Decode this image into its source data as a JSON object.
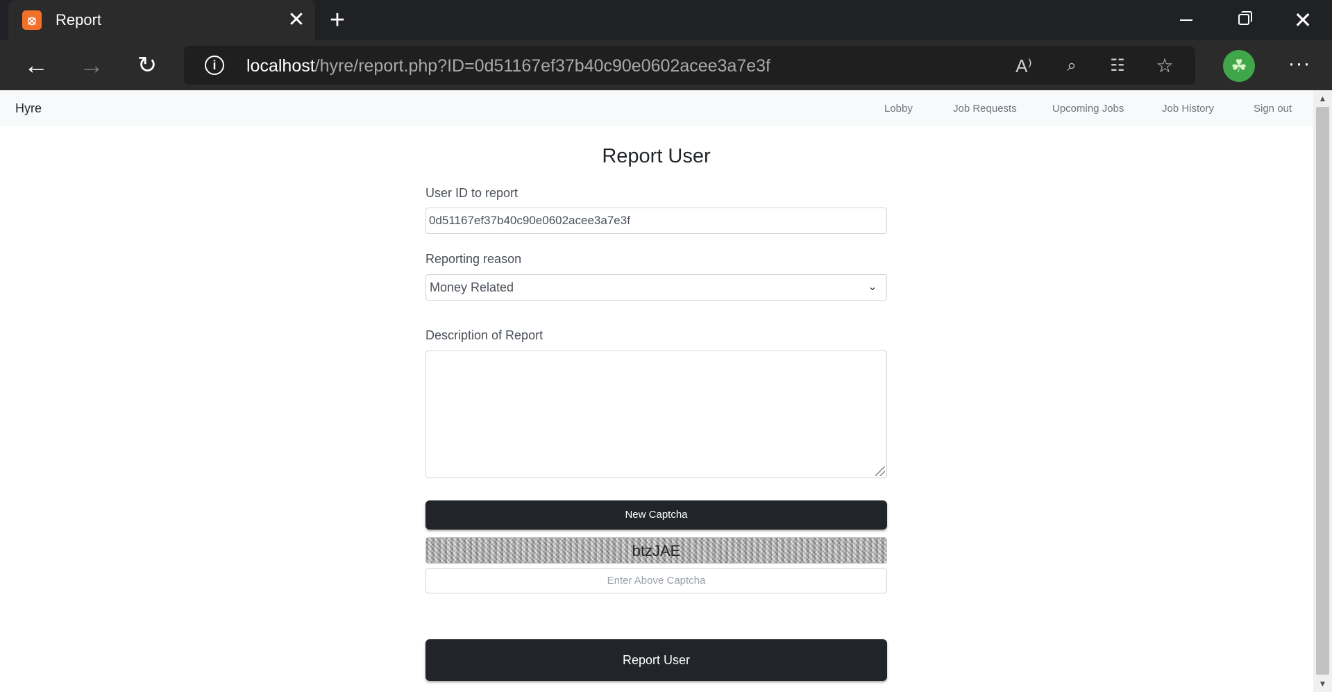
{
  "browser": {
    "tab_title": "Report",
    "favicon_glyph": "⦻",
    "new_tab_glyph": "+",
    "tab_close_glyph": "✕",
    "win_close_glyph": "✕",
    "url_host": "localhost",
    "url_path": "/hyre/report.php?ID=0d51167ef37b40c90e0602acee3a7e3f",
    "back_glyph": "←",
    "forward_glyph": "→",
    "reload_glyph": "↻",
    "info_glyph": "i",
    "read_aloud_glyph": "A⁾",
    "zoom_glyph": "⌕",
    "profiles_glyph": "☷",
    "favorites_glyph": "☆",
    "avatar_glyph": "☘",
    "menu_glyph": "···",
    "accent": "#3fa64a"
  },
  "site": {
    "brand": "Hyre",
    "nav": [
      "Lobby",
      "Job Requests",
      "Upcoming Jobs",
      "Job History",
      "Sign out"
    ]
  },
  "form": {
    "title": "Report User",
    "user_id_label": "User ID to report",
    "user_id_value": "0d51167ef37b40c90e0602acee3a7e3f",
    "reason_label": "Reporting reason",
    "reason_selected": "Money Related",
    "chevron_glyph": "⌄",
    "description_label": "Description of Report",
    "description_value": "",
    "new_captcha_label": "New Captcha",
    "captcha_text": "btzJAE",
    "captcha_placeholder": "Enter Above Captcha",
    "submit_label": "Report User"
  },
  "scrollbar": {
    "up_glyph": "▲",
    "down_glyph": "▼"
  }
}
